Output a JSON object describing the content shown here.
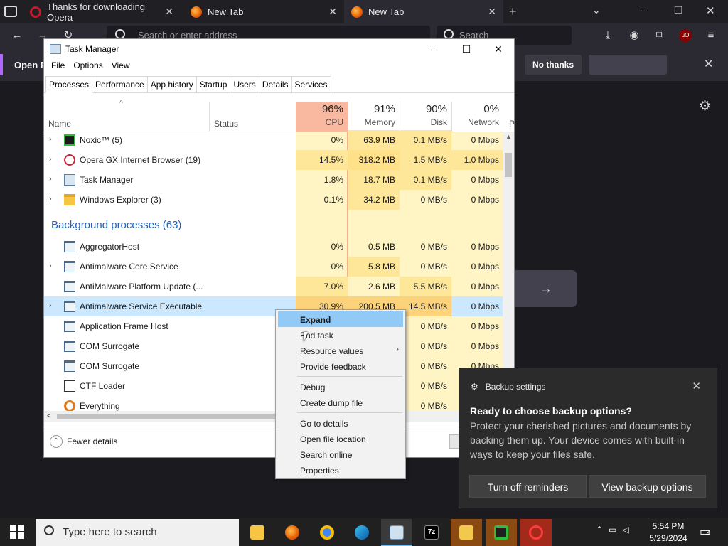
{
  "browser": {
    "tabs": [
      {
        "title": "Thanks for downloading Opera",
        "close": "✕",
        "color": "#c41a2b"
      },
      {
        "title": "New Tab",
        "close": "✕",
        "color": "#e66000"
      },
      {
        "title": "New Tab",
        "close": "✕",
        "color": "#e66000"
      }
    ],
    "new_tab": "+",
    "url_placeholder": "Search or enter address",
    "search_placeholder": "Search",
    "notification": {
      "text": "Open F",
      "no_thanks": "No thanks",
      "close": "✕"
    },
    "window_controls": {
      "minimize": "–",
      "restore": "❐",
      "close": "✕"
    }
  },
  "task_manager": {
    "title": "Task Manager",
    "window_controls": {
      "minimize": "–",
      "maximize": "☐",
      "close": "✕"
    },
    "menu": [
      "File",
      "Options",
      "View"
    ],
    "tabs": [
      "Processes",
      "Performance",
      "App history",
      "Startup",
      "Users",
      "Details",
      "Services"
    ],
    "active_tab": "Processes",
    "columns": {
      "name": "Name",
      "status": "Status",
      "cpu": {
        "pct": "96%",
        "label": "CPU"
      },
      "memory": {
        "pct": "91%",
        "label": "Memory"
      },
      "disk": {
        "pct": "90%",
        "label": "Disk"
      },
      "network": {
        "pct": "0%",
        "label": "Network"
      },
      "power_trunc": "P"
    },
    "apps": [
      {
        "name": "Noxic™ (5)",
        "cpu": "0%",
        "mem": "63.9 MB",
        "disk": "0.1 MB/s",
        "net": "0 Mbps",
        "icon": "nox-icon"
      },
      {
        "name": "Opera GX Internet Browser (19)",
        "cpu": "14.5%",
        "mem": "318.2 MB",
        "disk": "1.5 MB/s",
        "net": "1.0 Mbps",
        "icon": "opera-icon"
      },
      {
        "name": "Task Manager",
        "cpu": "1.8%",
        "mem": "18.7 MB",
        "disk": "0.1 MB/s",
        "net": "0 Mbps",
        "icon": "task-manager-icon"
      },
      {
        "name": "Windows Explorer (3)",
        "cpu": "0.1%",
        "mem": "34.2 MB",
        "disk": "0 MB/s",
        "net": "0 Mbps",
        "icon": "folder-icon"
      }
    ],
    "background_title": "Background processes (63)",
    "background": [
      {
        "name": "AggregatorHost",
        "cpu": "0%",
        "mem": "0.5 MB",
        "disk": "0 MB/s",
        "net": "0 Mbps"
      },
      {
        "name": "Antimalware Core Service",
        "cpu": "0%",
        "mem": "5.8 MB",
        "disk": "0 MB/s",
        "net": "0 Mbps"
      },
      {
        "name": "AntiMalware Platform Update (...",
        "cpu": "7.0%",
        "mem": "2.6 MB",
        "disk": "5.5 MB/s",
        "net": "0 Mbps"
      },
      {
        "name": "Antimalware Service Executable",
        "cpu": "30.9%",
        "mem": "200.5 MB",
        "disk": "14.5 MB/s",
        "net": "0 Mbps"
      },
      {
        "name": "Application Frame Host",
        "cpu": "",
        "mem": "",
        "disk": "0 MB/s",
        "net": "0 Mbps"
      },
      {
        "name": "COM Surrogate",
        "cpu": "",
        "mem": "",
        "disk": "0 MB/s",
        "net": "0 Mbps"
      },
      {
        "name": "COM Surrogate",
        "cpu": "",
        "mem": "",
        "disk": "0 MB/s",
        "net": "0 Mbps"
      },
      {
        "name": "CTF Loader",
        "cpu": "",
        "mem": "",
        "disk": "0 MB/s",
        "net": ""
      },
      {
        "name": "Everything",
        "cpu": "",
        "mem": "",
        "disk": "0 MB/s",
        "net": ""
      }
    ],
    "fewer_details": "Fewer details",
    "expand_glyph": "›"
  },
  "context_menu": {
    "items": [
      "Expand",
      "End task",
      "Resource values",
      "Provide feedback",
      "Debug",
      "Create dump file",
      "Go to details",
      "Open file location",
      "Search online",
      "Properties"
    ],
    "submenu_arrow": "›"
  },
  "toast": {
    "header": "Backup settings",
    "title": "Ready to choose backup options?",
    "body": "Protect your cherished pictures and documents by backing them up. Your device comes with built-in ways to keep your files safe.",
    "btn_off": "Turn off reminders",
    "btn_view": "View backup options",
    "close": "✕"
  },
  "taskbar": {
    "search_placeholder": "Type here to search",
    "time": "5:54 PM",
    "date": "5/29/2024",
    "notification_count": "2"
  },
  "colors": {
    "cpu_header": "#f9b9a0",
    "heat_light": "#fff4c4",
    "heat_medium": "#ffe79a",
    "selection": "#cce8ff",
    "menu_highlight": "#91c9f7",
    "background_group": "#1f5fbf"
  }
}
